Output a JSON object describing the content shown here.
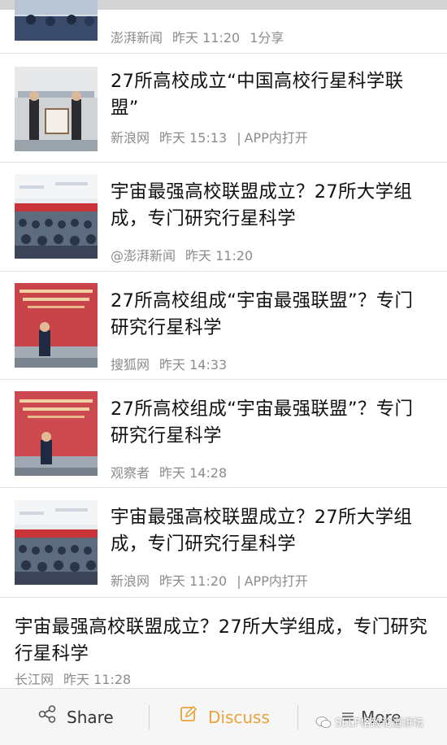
{
  "articles": [
    {
      "title": "",
      "source": "澎湃新闻",
      "time": "昨天 11:20",
      "extra": "1分享"
    },
    {
      "title": "27所高校成立“中国高校行星科学联盟”",
      "source": "新浪网",
      "time": "昨天 15:13",
      "extra": "APP内打开"
    },
    {
      "title": "宇宙最强高校联盟成立？27所大学组成，专门研究行星科学",
      "source": "@澎湃新闻",
      "time": "昨天 11:20",
      "extra": ""
    },
    {
      "title": "27所高校组成“宇宙最强联盟”？专门研究行星科学",
      "source": "搜狐网",
      "time": "昨天 14:33",
      "extra": ""
    },
    {
      "title": "27所高校组成“宇宙最强联盟”？专门研究行星科学",
      "source": "观察者",
      "time": "昨天 14:28",
      "extra": ""
    },
    {
      "title": "宇宙最强高校联盟成立？27所大学组成，专门研究行星科学",
      "source": "新浪网",
      "time": "昨天 11:20",
      "extra": "APP内打开"
    },
    {
      "title": "宇宙最强高校联盟成立？27所大学组成，专门研究行星科学",
      "source": "长江网",
      "time": "昨天 11:28",
      "extra": ""
    }
  ],
  "bottom_bar": {
    "share_label": "Share",
    "discuss_label": "Discuss",
    "more_label": "More",
    "share_icon": "share-icon",
    "discuss_icon": "edit-icon",
    "more_icon": "menu-icon"
  },
  "watermark": {
    "text": "SELF格致论道讲坛"
  },
  "colors": {
    "accent": "#e8a33c",
    "meta_text": "#8c8c8c",
    "title_text": "#111111"
  }
}
